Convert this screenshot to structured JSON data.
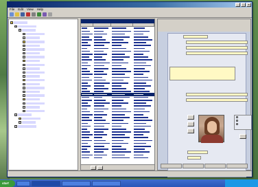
{
  "window": {
    "title": "",
    "menus": [
      "File",
      "Edit",
      "View",
      "Help"
    ]
  },
  "tree": {
    "rows": 28
  },
  "grid": {
    "caption": "",
    "columns": [
      "",
      "",
      "",
      ""
    ],
    "row_count": 46,
    "selected_row": 23,
    "nav": [
      "",
      ""
    ]
  },
  "form": {
    "tabs": [
      "",
      "",
      "",
      ""
    ],
    "radio_options": [
      "",
      "",
      ""
    ]
  },
  "taskbar": {
    "start_label": "start",
    "clock": ""
  },
  "colors": {
    "title_blue": "#0a246a",
    "field_yellow": "#fff9c4",
    "grid_text": "#1a2f8f",
    "tree_highlight": "#d9d9ff"
  }
}
